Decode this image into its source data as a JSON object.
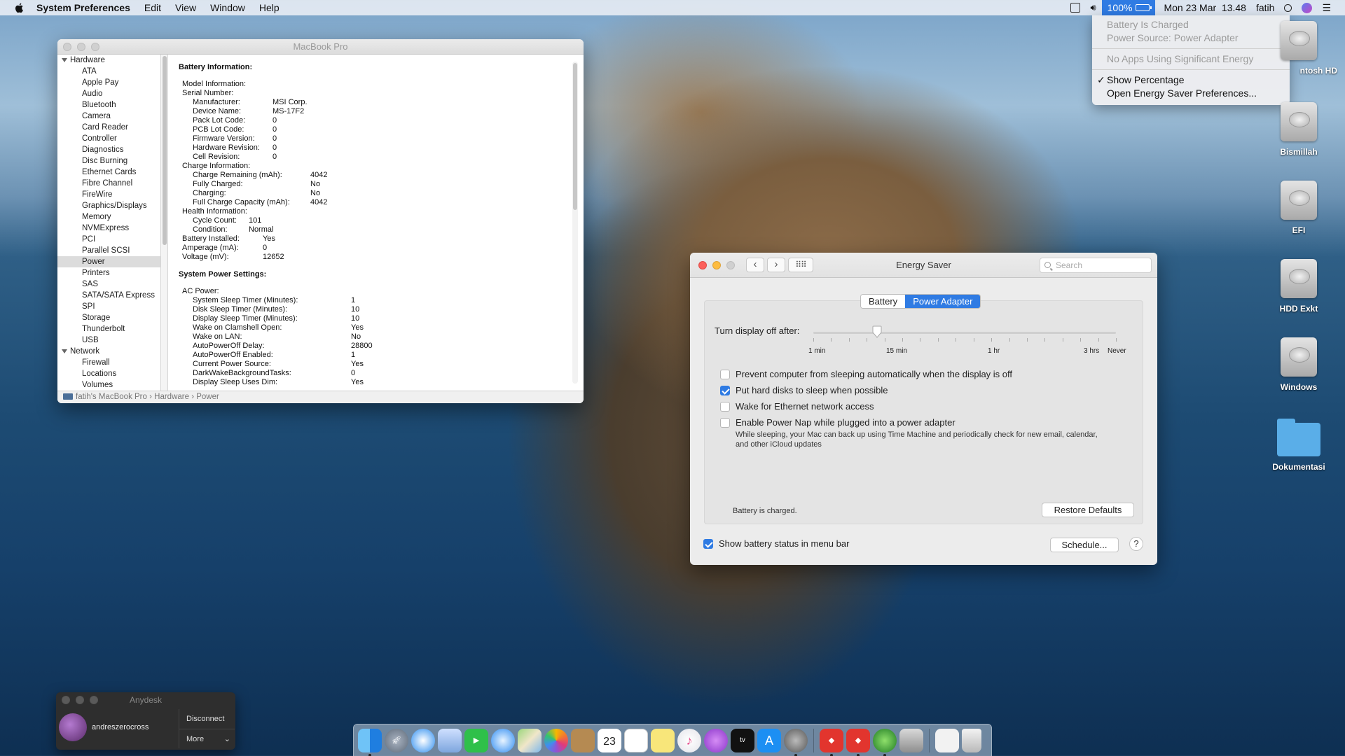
{
  "menubar": {
    "app_name": "System Preferences",
    "menus": [
      "Edit",
      "View",
      "Window",
      "Help"
    ],
    "battery_percent": "100%",
    "datetime": "Mon 23 Mar  13.48",
    "user": "fatih"
  },
  "battery_menu": {
    "status": "Battery Is Charged",
    "power_source": "Power Source: Power Adapter",
    "apps": "No Apps Using Significant Energy",
    "show_percentage": "Show Percentage",
    "open_prefs": "Open Energy Saver Preferences..."
  },
  "system_info": {
    "title": "MacBook Pro",
    "sidebar_hardware": "Hardware",
    "hardware_items": [
      "ATA",
      "Apple Pay",
      "Audio",
      "Bluetooth",
      "Camera",
      "Card Reader",
      "Controller",
      "Diagnostics",
      "Disc Burning",
      "Ethernet Cards",
      "Fibre Channel",
      "FireWire",
      "Graphics/Displays",
      "Memory",
      "NVMExpress",
      "PCI",
      "Parallel SCSI",
      "Power",
      "Printers",
      "SAS",
      "SATA/SATA Express",
      "SPI",
      "Storage",
      "Thunderbolt",
      "USB"
    ],
    "selected_item": "Power",
    "sidebar_network": "Network",
    "network_items": [
      "Firewall",
      "Locations",
      "Volumes"
    ],
    "battery_heading": "Battery Information:",
    "power_heading": "System Power Settings:",
    "battery_rows": [
      [
        "Model Information:",
        ""
      ],
      [
        "Serial Number:",
        ""
      ],
      [
        "Manufacturer:",
        "MSI Corp."
      ],
      [
        "Device Name:",
        "MS-17F2"
      ],
      [
        "Pack Lot Code:",
        "0"
      ],
      [
        "PCB Lot Code:",
        "0"
      ],
      [
        "Firmware Version:",
        "0"
      ],
      [
        "Hardware Revision:",
        "0"
      ],
      [
        "Cell Revision:",
        "0"
      ],
      [
        "Charge Information:",
        ""
      ],
      [
        "Charge Remaining (mAh):",
        "4042"
      ],
      [
        "Fully Charged:",
        "No"
      ],
      [
        "Charging:",
        "No"
      ],
      [
        "Full Charge Capacity (mAh):",
        "4042"
      ],
      [
        "Health Information:",
        ""
      ],
      [
        "Cycle Count:",
        "101"
      ],
      [
        "Condition:",
        "Normal"
      ],
      [
        "Battery Installed:",
        "Yes"
      ],
      [
        "Amperage (mA):",
        "0"
      ],
      [
        "Voltage (mV):",
        "12652"
      ]
    ],
    "power_rows": [
      [
        "AC Power:",
        ""
      ],
      [
        "System Sleep Timer (Minutes):",
        "1"
      ],
      [
        "Disk Sleep Timer (Minutes):",
        "10"
      ],
      [
        "Display Sleep Timer (Minutes):",
        "10"
      ],
      [
        "Wake on Clamshell Open:",
        "Yes"
      ],
      [
        "Wake on LAN:",
        "No"
      ],
      [
        "AutoPowerOff Delay:",
        "28800"
      ],
      [
        "AutoPowerOff Enabled:",
        "1"
      ],
      [
        "Current Power Source:",
        "Yes"
      ],
      [
        "DarkWakeBackgroundTasks:",
        "0"
      ],
      [
        "Display Sleep Uses Dim:",
        "Yes"
      ]
    ],
    "path": [
      "fatih's MacBook Pro",
      "Hardware",
      "Power"
    ]
  },
  "energy_saver": {
    "title": "Energy Saver",
    "search_placeholder": "Search",
    "tabs": [
      "Battery",
      "Power Adapter"
    ],
    "active_tab": "Power Adapter",
    "slider_label": "Turn display off after:",
    "slider_value": "10 min",
    "slider_ticks": [
      "1 min",
      "15 min",
      "1 hr",
      "3 hrs",
      "Never"
    ],
    "options": [
      {
        "label": "Prevent computer from sleeping automatically when the display is off",
        "checked": false
      },
      {
        "label": "Put hard disks to sleep when possible",
        "checked": true
      },
      {
        "label": "Wake for Ethernet network access",
        "checked": false
      },
      {
        "label": "Enable Power Nap while plugged into a power adapter",
        "checked": false
      }
    ],
    "power_nap_note": "While sleeping, your Mac can back up using Time Machine and periodically check for new email, calendar, and other iCloud updates",
    "battery_status": "Battery is charged.",
    "restore_defaults": "Restore Defaults",
    "show_battery_status": "Show battery status in menu bar",
    "show_battery_checked": true,
    "schedule": "Schedule...",
    "help": "?"
  },
  "desktop_icons": [
    {
      "label": "ntosh HD",
      "icon": "hard-drive-icon"
    },
    {
      "label": "Bismillah",
      "icon": "hard-drive-icon"
    },
    {
      "label": "EFI",
      "icon": "hard-drive-icon"
    },
    {
      "label": "HDD Exkt",
      "icon": "hard-drive-icon"
    },
    {
      "label": "Windows",
      "icon": "hard-drive-icon"
    },
    {
      "label": "Dokumentasi",
      "icon": "folder-icon"
    }
  ],
  "anydesk": {
    "title": "Anydesk",
    "user": "andreszerocross",
    "disconnect": "Disconnect",
    "more": "More"
  },
  "dock": {
    "calendar_day": "23",
    "apps": [
      "Finder",
      "Launchpad",
      "Safari",
      "Preview",
      "FaceTime",
      "Messages",
      "Maps",
      "Photos",
      "Notes",
      "Calendar",
      "Reminders",
      "Stickies",
      "iTunes",
      "Podcasts",
      "TV",
      "App Store",
      "System Preferences",
      "AnyDesk",
      "AnyDesk",
      "Activity",
      "Clover",
      "Document",
      "Trash"
    ]
  }
}
